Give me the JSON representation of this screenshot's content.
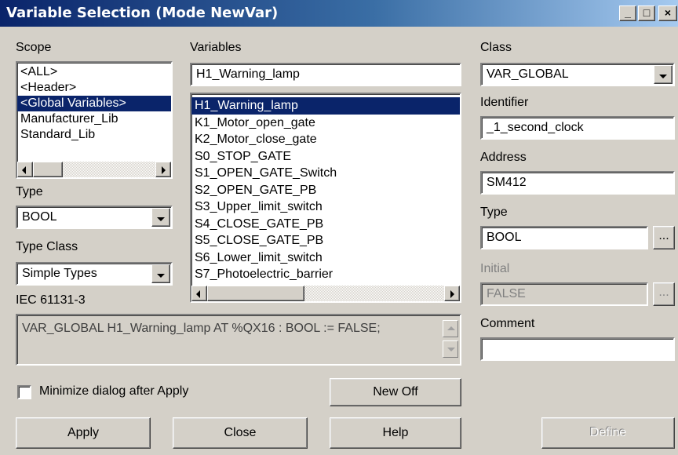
{
  "window": {
    "title": "Variable Selection (Mode NewVar)",
    "minimize": "_",
    "maximize": "□",
    "close": "×"
  },
  "scope": {
    "label": "Scope",
    "items": [
      "<ALL>",
      "<Header>",
      "<Global Variables>",
      "Manufacturer_Lib",
      "Standard_Lib"
    ],
    "selected": "<Global Variables>"
  },
  "type_filter": {
    "label": "Type",
    "value": "BOOL"
  },
  "type_class": {
    "label": "Type Class",
    "value": "Simple Types"
  },
  "iec": {
    "label": "IEC 61131-3",
    "text": "VAR_GLOBAL H1_Warning_lamp AT %QX16 : BOOL := FALSE;"
  },
  "variables": {
    "label": "Variables",
    "filter_value": "H1_Warning_lamp",
    "items": [
      "H1_Warning_lamp",
      "K1_Motor_open_gate",
      "K2_Motor_close_gate",
      "S0_STOP_GATE",
      "S1_OPEN_GATE_Switch",
      "S2_OPEN_GATE_PB",
      "S3_Upper_limit_switch",
      "S4_CLOSE_GATE_PB",
      "S5_CLOSE_GATE_PB",
      "S6_Lower_limit_switch",
      "S7_Photoelectric_barrier"
    ],
    "selected": "H1_Warning_lamp"
  },
  "details": {
    "class_label": "Class",
    "class_value": "VAR_GLOBAL",
    "identifier_label": "Identifier",
    "identifier_value": "_1_second_clock",
    "address_label": "Address",
    "address_value": "SM412",
    "type_label": "Type",
    "type_value": "BOOL",
    "initial_label": "Initial",
    "initial_value": "FALSE",
    "comment_label": "Comment",
    "comment_value": "",
    "browse": "..."
  },
  "options": {
    "minimize_after_apply": "Minimize dialog after Apply",
    "minimize_checked": false
  },
  "buttons": {
    "new_off": "New Off",
    "apply": "Apply",
    "close": "Close",
    "help": "Help",
    "define": "Define"
  }
}
